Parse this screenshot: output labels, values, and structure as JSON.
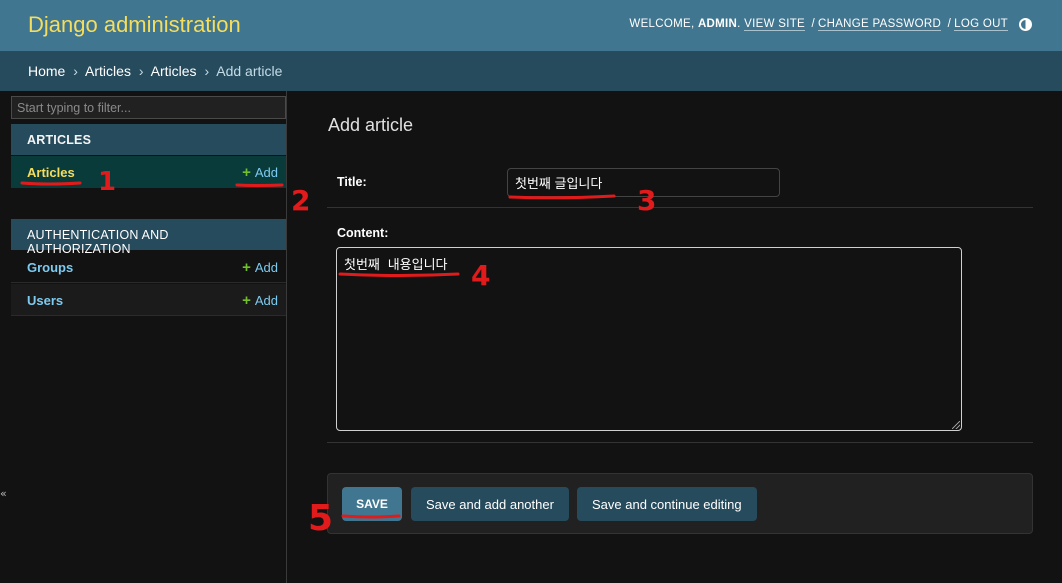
{
  "header": {
    "brand": "Django administration",
    "welcome": "WELCOME, ",
    "username": "ADMIN",
    "period": ".",
    "links": [
      "VIEW SITE",
      "CHANGE PASSWORD",
      "LOG OUT"
    ],
    "separator": "/"
  },
  "breadcrumbs": {
    "items": [
      "Home",
      "Articles",
      "Articles",
      "Add article"
    ],
    "separator": "›"
  },
  "sidebar": {
    "filter_placeholder": "Start typing to filter...",
    "modules": [
      {
        "caption": "ARTICLES",
        "models": [
          {
            "name": "Articles",
            "add_label": "Add"
          }
        ]
      },
      {
        "caption": "AUTHENTICATION AND AUTHORIZATION",
        "models": [
          {
            "name": "Groups",
            "add_label": "Add"
          },
          {
            "name": "Users",
            "add_label": "Add"
          }
        ]
      }
    ],
    "collapse_glyph": "«"
  },
  "content": {
    "title": "Add article",
    "fields": {
      "title_label": "Title:",
      "title_value": "첫번째 글입니다",
      "content_label": "Content:",
      "content_value": "첫번째 내용입니다"
    },
    "buttons": {
      "save": "SAVE",
      "save_add_another": "Save and add another",
      "save_continue": "Save and continue editing"
    }
  },
  "annotations": {
    "color": "#e11b1b",
    "labels": [
      "1",
      "2",
      "3",
      "4",
      "5"
    ]
  },
  "icons": {
    "add": "plus-icon",
    "theme": "theme-toggle-icon"
  },
  "colors": {
    "header_bg": "#417690",
    "brand": "#f5dd5d",
    "breadcrumbs_bg": "#264b5d",
    "link": "#7dcbf0",
    "add_plus": "#70bf2b",
    "body_bg": "#121212"
  }
}
